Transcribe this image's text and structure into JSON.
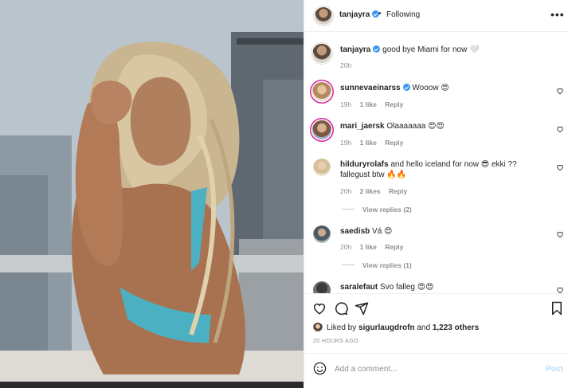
{
  "post": {
    "author": "tanjayra",
    "follow_state": "Following",
    "separator": "•",
    "more_icon": "more-horizontal-icon",
    "caption": "good bye Miami for now 🤍",
    "caption_time": "20h"
  },
  "comments": [
    {
      "user": "sunnevaeinarss",
      "verified": true,
      "text": "Wooow 😍",
      "time": "19h",
      "likes": "1 like",
      "reply": "Reply"
    },
    {
      "user": "mari_jaersk",
      "verified": false,
      "text": "Olaaaaaaa 😍😍",
      "time": "19h",
      "likes": "1 like",
      "reply": "Reply"
    },
    {
      "user": "hilduryrolafs",
      "verified": false,
      "text": "and hello iceland for now 😎 ekki ?? fallegust btw 🔥🔥",
      "time": "20h",
      "likes": "2 likes",
      "reply": "Reply",
      "view_replies": "View replies (2)"
    },
    {
      "user": "saedisb",
      "verified": false,
      "text": "Vá 😍",
      "time": "20h",
      "likes": "1 like",
      "reply": "Reply",
      "view_replies": "View replies (1)"
    },
    {
      "user": "saralefaut",
      "verified": false,
      "text": "Svo falleg 😍😍"
    }
  ],
  "actions": {
    "like_icon": "heart-icon",
    "comment_icon": "comment-icon",
    "share_icon": "share-icon",
    "save_icon": "bookmark-icon"
  },
  "likes": {
    "prefix": "Liked by",
    "user": "sigurlaugdrofn",
    "joiner": "and",
    "others": "1,223 others"
  },
  "time_ago": "20 HOURS AGO",
  "comment_box": {
    "emoji_icon": "smiley-icon",
    "placeholder": "Add a comment...",
    "post_label": "Post"
  },
  "colors": {
    "verified": "#3897f0",
    "post_disabled": "#b2dffc",
    "muted": "#8e8e8e",
    "story_ring": "#d6249f"
  }
}
